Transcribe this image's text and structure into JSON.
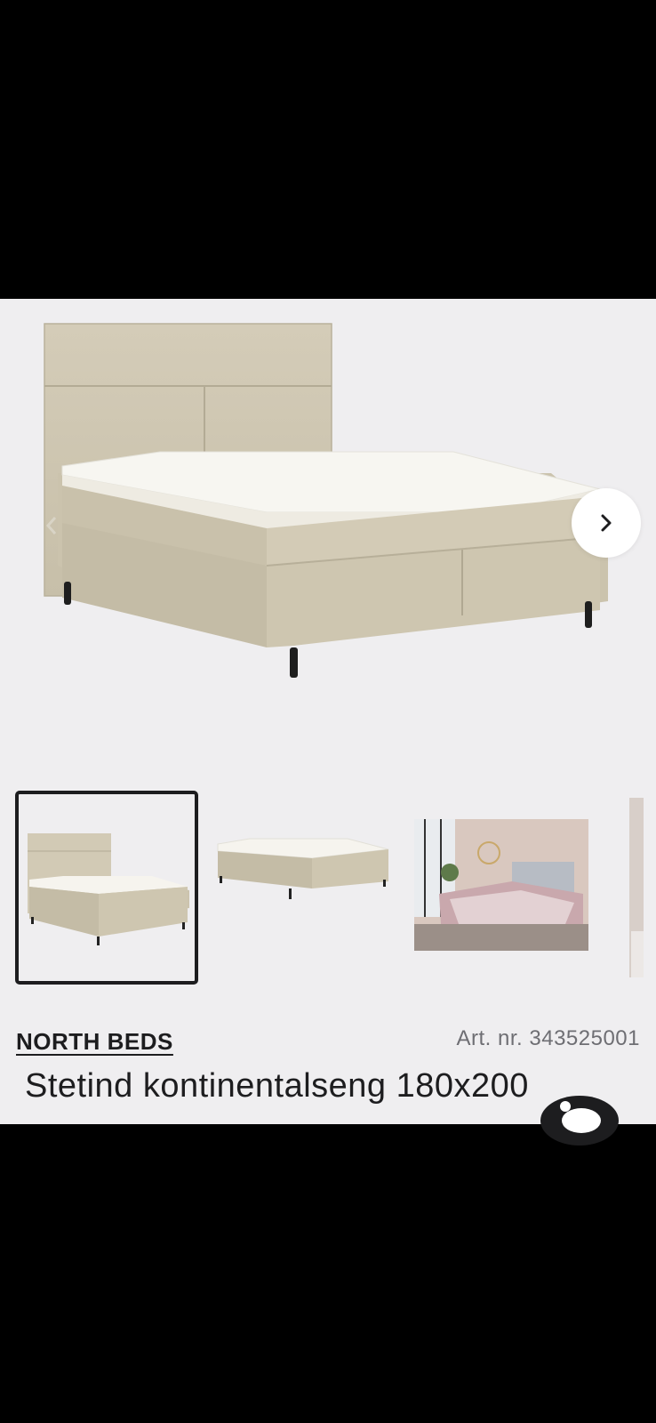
{
  "product": {
    "brand": "NORTH BEDS",
    "article_number": "Art. nr. 343525001",
    "title": "Stetind kontinentalseng 180x200"
  },
  "gallery": {
    "next_icon": "chevron-right-icon",
    "prev_icon": "chevron-left-icon",
    "thumbnails": [
      "bed-with-headboard",
      "bed-without-headboard",
      "bedroom-scene",
      "partial-next-image"
    ],
    "active_index": 0
  },
  "chat": {
    "icon": "chat-bubble-icon"
  },
  "colors": {
    "background": "#efeef0",
    "fabric": "#cfc7b2",
    "text": "#1d1d1f",
    "muted": "#6e6e73"
  }
}
